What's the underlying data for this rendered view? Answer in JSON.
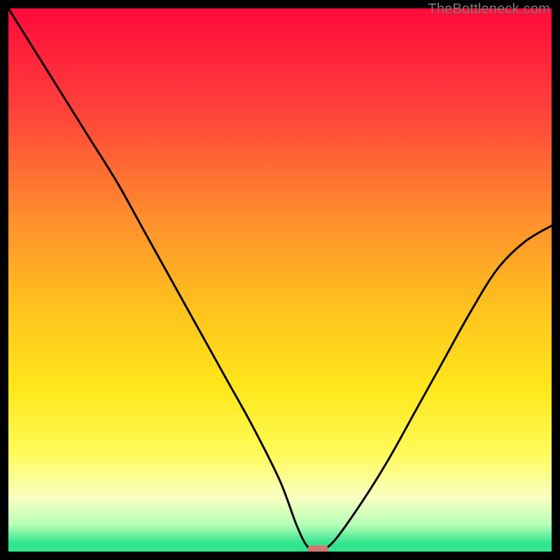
{
  "watermark": "TheBottleneck.com",
  "chart_data": {
    "type": "line",
    "title": "",
    "xlabel": "",
    "ylabel": "",
    "xlim": [
      0,
      100
    ],
    "ylim": [
      0,
      100
    ],
    "grid": false,
    "legend": false,
    "background": {
      "type": "vertical-gradient",
      "stops": [
        {
          "pos": 0.0,
          "color": "#ff0a3a"
        },
        {
          "pos": 0.18,
          "color": "#ff3f3b"
        },
        {
          "pos": 0.38,
          "color": "#ff8c2e"
        },
        {
          "pos": 0.55,
          "color": "#ffc21e"
        },
        {
          "pos": 0.7,
          "color": "#ffe71a"
        },
        {
          "pos": 0.82,
          "color": "#fffb5a"
        },
        {
          "pos": 0.9,
          "color": "#fbffc2"
        },
        {
          "pos": 0.95,
          "color": "#b7ffb7"
        },
        {
          "pos": 0.985,
          "color": "#31e58e"
        },
        {
          "pos": 1.0,
          "color": "#31e58e"
        }
      ]
    },
    "series": [
      {
        "name": "bottleneck-curve",
        "x": [
          0,
          5,
          10,
          15,
          20,
          25,
          30,
          35,
          40,
          45,
          50,
          53,
          55,
          57,
          60,
          65,
          70,
          75,
          80,
          85,
          90,
          95,
          100
        ],
        "y": [
          100,
          92,
          84,
          76,
          68,
          59,
          50,
          41,
          32,
          23,
          13,
          5,
          1,
          0,
          2,
          9,
          17,
          26,
          35,
          44,
          52,
          57,
          60
        ]
      }
    ],
    "marker": {
      "name": "optimum-marker",
      "x": 57,
      "y": 0,
      "color": "#d07a6e",
      "shape": "rounded-rect"
    }
  }
}
